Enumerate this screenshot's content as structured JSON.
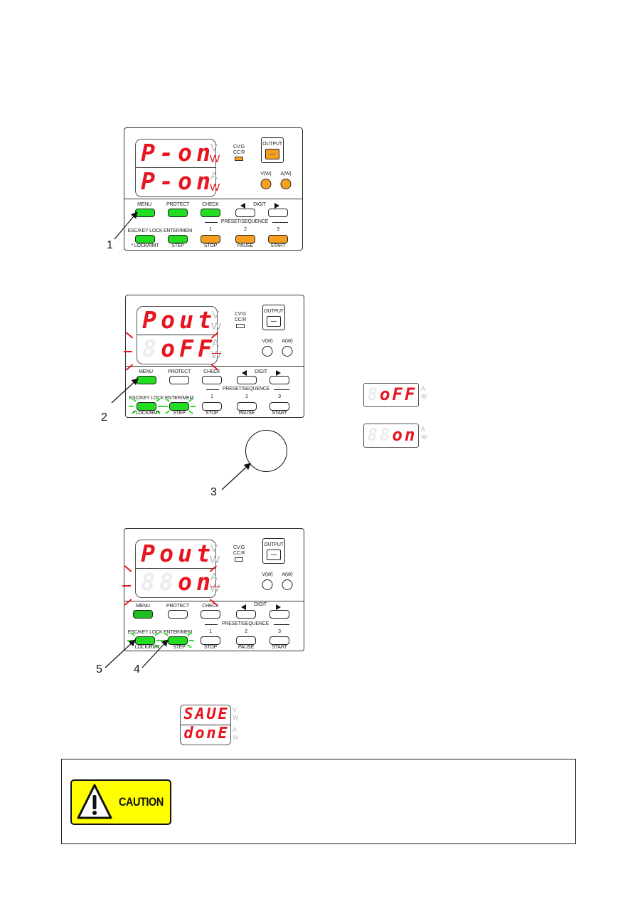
{
  "panel1": {
    "display_top": [
      "P",
      "-",
      "o",
      "n"
    ],
    "display_bottom": [
      "P",
      "-",
      "o",
      "n"
    ],
    "unit_top": [
      "V",
      "W"
    ],
    "unit_bottom": [
      "A",
      "W"
    ],
    "unit_lit": "W",
    "cv_label": "CV:G",
    "cc_label": "CC:R",
    "output_label": "OUTPUT",
    "v_label": "V(W)",
    "a_label": "A(W)",
    "state": "output-on"
  },
  "panel2": {
    "display_top": [
      "P",
      "o",
      "u",
      "t"
    ],
    "display_bottom": [
      "",
      "o",
      "F",
      "F"
    ],
    "unit_top": [
      "V",
      "W"
    ],
    "unit_bottom": [
      "A",
      "W"
    ],
    "cv_label": "CV:G",
    "cc_label": "CC:R",
    "output_label": "OUTPUT",
    "v_label": "V(W)",
    "a_label": "A(W)"
  },
  "panel3": {
    "display_top": [
      "P",
      "o",
      "u",
      "t"
    ],
    "display_bottom": [
      "",
      "",
      "o",
      "n"
    ],
    "unit_top": [
      "V",
      "W"
    ],
    "unit_bottom": [
      "A",
      "W"
    ],
    "cv_label": "CV:G",
    "cc_label": "CC:R",
    "output_label": "OUTPUT",
    "v_label": "V(W)",
    "a_label": "A(W)"
  },
  "keys": {
    "menu": "MENU",
    "protect": "PROTECT",
    "check": "CHECK",
    "digit": "DIGIT",
    "esc": "ESC/KEY LOCK",
    "enter": "ENTER/MEM",
    "preset": "PRESET/SEQUENCE",
    "p1": "1",
    "p2": "2",
    "p3": "3",
    "lock": "* LOCK/RMT",
    "lock2": "LOCK/RMT",
    "step": "STEP",
    "stop": "STOP",
    "pause": "PAUSE",
    "start": "START"
  },
  "steps": {
    "s1": "1",
    "s2": "2",
    "s3": "3",
    "s4": "4",
    "s5": "5"
  },
  "option_displays": {
    "off": {
      "chars": [
        "",
        "o",
        "F",
        "F"
      ],
      "units": [
        "A",
        "W"
      ]
    },
    "on": {
      "chars": [
        "",
        "",
        "o",
        "n"
      ],
      "units": [
        "A",
        "W"
      ]
    }
  },
  "save_display": {
    "top": [
      "S",
      "A",
      "U",
      "E"
    ],
    "bottom": [
      "d",
      "o",
      "n",
      "E"
    ],
    "unit_top": [
      "V",
      "W"
    ],
    "unit_bottom": [
      "A",
      "W"
    ]
  },
  "caution": {
    "label": "CAUTION",
    "icon": "warning-triangle-icon"
  },
  "colors": {
    "segment_red": "#e8141e",
    "key_green": "#22dd22",
    "key_orange": "#f7a020",
    "caution_yellow": "#ffff00"
  }
}
